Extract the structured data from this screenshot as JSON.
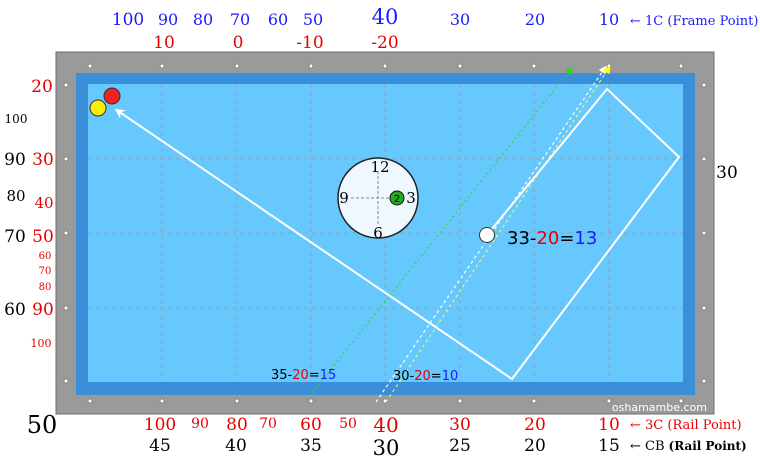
{
  "colors": {
    "blue": "#1a1aff",
    "red": "#e60000",
    "black": "#000000",
    "frame": "#999999",
    "rail": "#3a8fd8",
    "cloth": "#66c8fc",
    "grid": "#9aa9b8"
  },
  "top_labels": {
    "frame_blue": [
      "100",
      "90",
      "80",
      "70",
      "60",
      "50",
      "40",
      "30",
      "20",
      "10"
    ],
    "frame_red": [
      "10",
      "0",
      "-10",
      "-20"
    ],
    "frame_note": "← 1C (Frame Point)"
  },
  "left_labels": {
    "red_main": [
      "20",
      "30",
      "40",
      "50",
      "90",
      "100"
    ],
    "red_small": [
      "60",
      "70",
      "80"
    ],
    "black": [
      "100",
      "90",
      "80",
      "70",
      "60"
    ],
    "bottom_big": "50"
  },
  "right_labels": {
    "right_30": "30"
  },
  "bottom_labels": {
    "red": [
      "100",
      "90",
      "80",
      "70",
      "60",
      "50",
      "40",
      "30",
      "20",
      "10"
    ],
    "black": [
      "45",
      "40",
      "35",
      "30",
      "25",
      "20",
      "15"
    ],
    "rail_note_3c": "← 3C (Rail Point)",
    "rail_note_cb_arrow": "← CB",
    "rail_note_cb_bold": "(Rail Point)"
  },
  "clock": {
    "n12": "12",
    "n3": "3",
    "n6": "6",
    "n9": "9",
    "center_ball": "2"
  },
  "formulas": {
    "main": {
      "a": "33",
      "b": "20",
      "c": "13"
    },
    "left": {
      "a": "35",
      "b": "20",
      "c": "15"
    },
    "right": {
      "a": "30",
      "b": "20",
      "c": "10"
    }
  },
  "watermark": "oshamambe.com"
}
